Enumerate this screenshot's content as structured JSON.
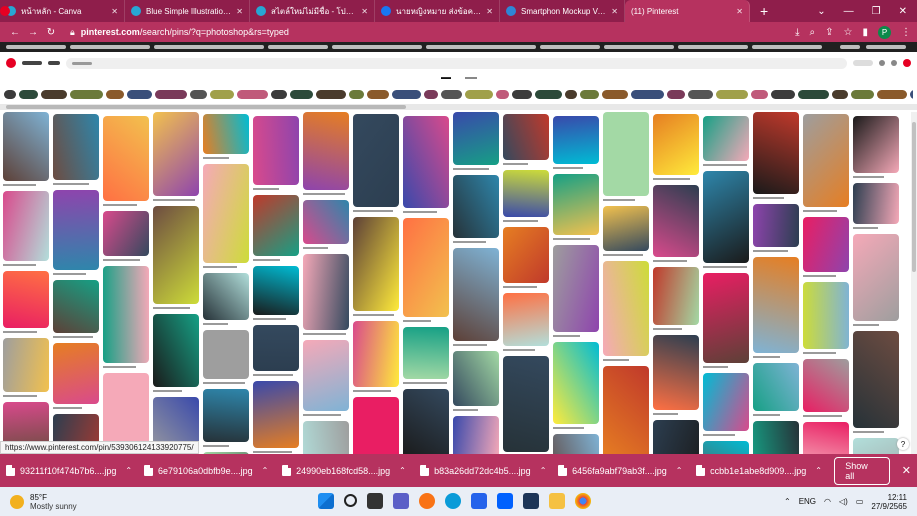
{
  "browser": {
    "tabs": [
      {
        "title": "หน้าหลัก - Canva",
        "icon": "canva-icon"
      },
      {
        "title": "Blue Simple Illustration Rou",
        "icon": "canva-icon"
      },
      {
        "title": "สไตล์ใหม่ไม่มีชื่อ - โปสเตอร์",
        "icon": "canva-icon"
      },
      {
        "title": "นายหญิงหมาย ส่งข้อความถึงคุณ",
        "icon": "facebook-icon"
      },
      {
        "title": "Smartphon Mockup Vector",
        "icon": "globe-icon"
      },
      {
        "title": "(11) Pinterest",
        "icon": "pinterest-icon"
      }
    ],
    "new_tab_label": "+",
    "address": {
      "host": "pinterest.com",
      "path": "/search/pins/?q=photoshop&rs=typed"
    },
    "hover_url": "https://www.pinterest.com/pin/539306124133920775/"
  },
  "downloads": {
    "items": [
      "93211f10f474b7b6....jpg",
      "6e79106a0dbfb9e....jpg",
      "24990eb168fcd58....jpg",
      "b83a26dd72dc4b5....jpg",
      "6456fa9abf79ab3f....jpg",
      "ccbb1e1abe8d909....jpg"
    ],
    "show_all_label": "Show all",
    "close_label": "✕"
  },
  "taskbar": {
    "weather": {
      "temp": "85°F",
      "condition": "Mostly sunny"
    },
    "language": "ENG",
    "time": "12:11",
    "date": "27/9/2565"
  },
  "colors": {
    "chrome_accent": "#b6325f",
    "tab_strip": "#8f1e4b"
  }
}
